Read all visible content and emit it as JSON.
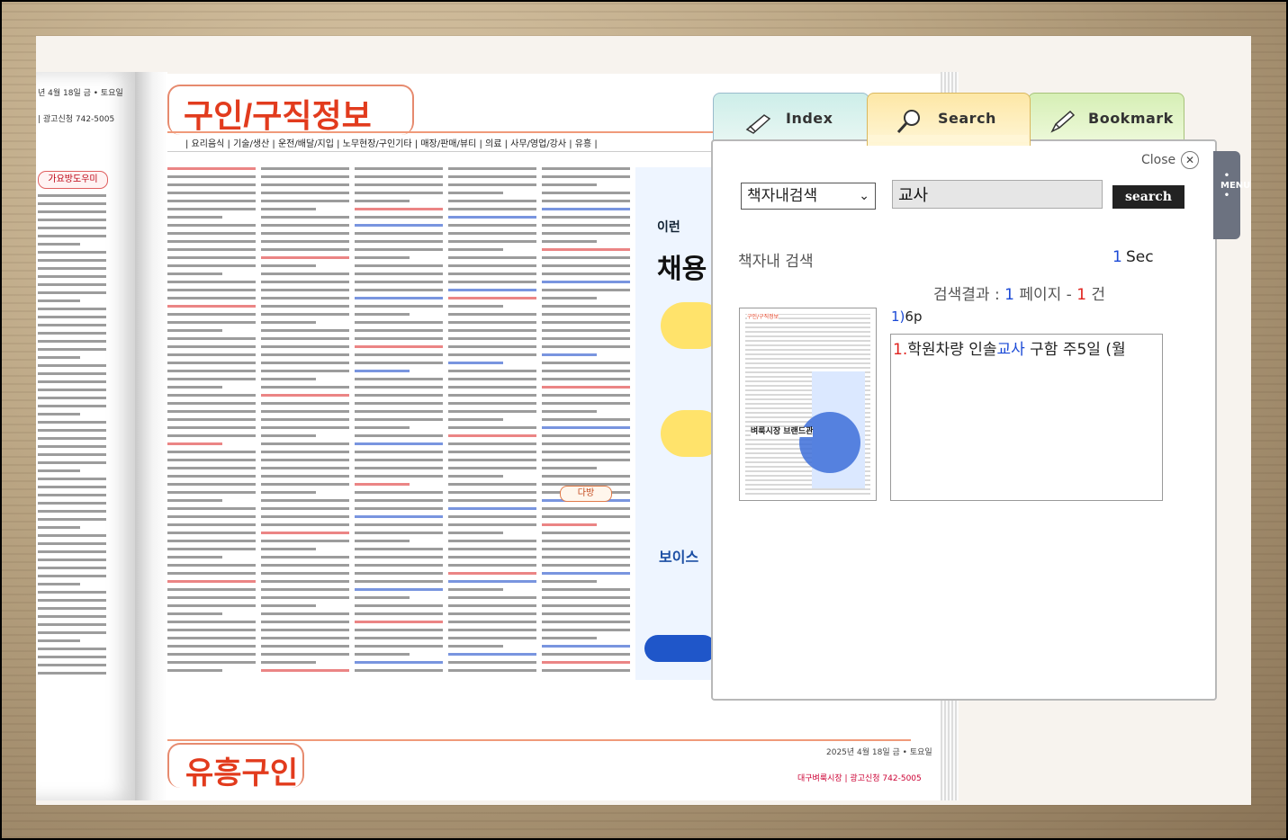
{
  "magazine": {
    "left_date": "년 4월 18일 금 • 토요일",
    "left_ad": "| 광고신청 742-5005",
    "left_badge": "가요방도우미",
    "title": "구인/구직정보",
    "categories": "| 요리음식 | 기술/생산 | 운전/배달/지입 | 노무현장/구인기타 | 매장/판매/뷰티 | 의료 | 사무/영업/강사 | 유흥 |",
    "category_tag": "다방",
    "ad_head1": "이런",
    "ad_head2": "채용",
    "ad_brand": "보이스",
    "lower_title": "유흥구인",
    "lower_date": "2025년 4월 18일 금 • 토요일",
    "lower_ad": "대구벼룩시장 | 광고신청 742-5005"
  },
  "tabs": [
    {
      "label": "Index",
      "icon": "index-hand-icon"
    },
    {
      "label": "Search",
      "icon": "magnifier-icon"
    },
    {
      "label": "Bookmark",
      "icon": "bookmark-pen-icon"
    }
  ],
  "panel": {
    "close_label": "Close",
    "scope_select": "책자내검색",
    "query": "교사",
    "search_button": "search",
    "scope_label": "책자내 검색",
    "time_num": "1",
    "time_unit": "Sec",
    "summary_prefix": "검색결과 : ",
    "summary_pages": "1",
    "summary_mid": " 페이지 - ",
    "summary_count": "1",
    "summary_suffix": " 건",
    "result_index": "1)",
    "result_page": "6p",
    "thumb_title": "구인/구직정보",
    "thumb_brand": "벼룩시장 브랜드관",
    "snippet_index": "1.",
    "snippet_before": "학원차량 인솔",
    "snippet_highlight": "교사",
    "snippet_after": " 구함 주5일 (월"
  },
  "menu_label": "• MENU •",
  "colors": {
    "accent_blue": "#1a49d6",
    "accent_red": "#e0221d",
    "title_red": "#e23b1d"
  }
}
